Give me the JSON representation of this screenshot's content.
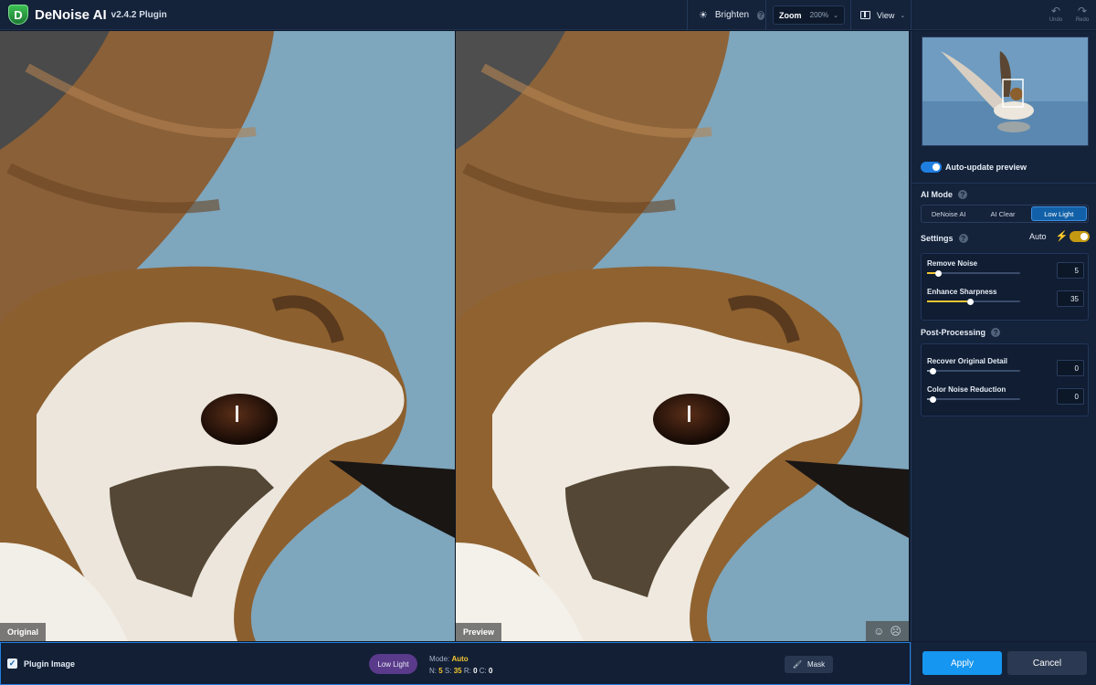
{
  "app": {
    "title": "DeNoise AI",
    "version": "v2.4.2 Plugin",
    "logo_letter": "D"
  },
  "toolbar": {
    "brighten_label": "Brighten",
    "help_glyph": "?",
    "zoom_label": "Zoom",
    "zoom_value": "200%",
    "view_label": "View",
    "undo_label": "Undo",
    "redo_label": "Redo"
  },
  "canvas": {
    "left_label": "Original",
    "right_label": "Preview"
  },
  "side": {
    "auto_update_label": "Auto-update preview",
    "auto_update_on": true,
    "ai_mode_title": "AI Mode",
    "modes": [
      {
        "label": "DeNoise AI",
        "active": false
      },
      {
        "label": "AI Clear",
        "active": false
      },
      {
        "label": "Low Light",
        "active": true
      }
    ],
    "settings_title": "Settings",
    "auto_label": "Auto",
    "settings_sliders": [
      {
        "label": "Remove Noise",
        "value": "5",
        "fraction": 0.12
      },
      {
        "label": "Enhance Sharpness",
        "value": "35",
        "fraction": 0.47
      }
    ],
    "post_title": "Post-Processing",
    "post_sliders": [
      {
        "label": "Recover Original Detail",
        "value": "0",
        "fraction": 0.06
      },
      {
        "label": "Color Noise Reduction",
        "value": "0",
        "fraction": 0.06
      }
    ]
  },
  "bottom": {
    "plugin_image_label": "Plugin Image",
    "plugin_image_checked": true,
    "mode_pill": "Low Light",
    "mode_label": "Mode:",
    "mode_value": "Auto",
    "n_label": "N:",
    "n_value": "5",
    "s_label": "S:",
    "s_value": "35",
    "r_label": "R:",
    "r_value": "0",
    "c_label": "C:",
    "c_value": "0",
    "mask_label": "Mask",
    "apply_label": "Apply",
    "cancel_label": "Cancel"
  },
  "colors": {
    "accent": "#1596f0",
    "slider_fill": "#f2c531",
    "pill": "#5a3a8a",
    "sky": "#7ea6bd"
  }
}
